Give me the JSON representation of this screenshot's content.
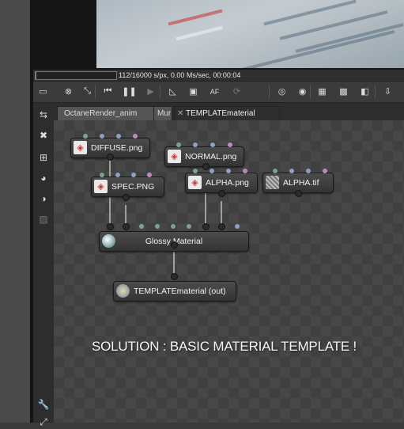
{
  "render": {
    "status": "112/16000 s/px, 0.00 Ms/sec, 00:00:04",
    "progress": 0.007
  },
  "toolbar": {
    "buttons": [
      {
        "name": "save-render-icon",
        "glyph": "▭"
      },
      {
        "name": "cancel-render-icon",
        "glyph": "⊗"
      },
      {
        "name": "fit-view-icon",
        "glyph": "⤡"
      },
      {
        "name": "restart-icon",
        "glyph": "⏮"
      },
      {
        "name": "pause-icon",
        "glyph": "❚❚"
      },
      {
        "name": "play-icon",
        "glyph": "▶"
      },
      {
        "name": "ruler-icon",
        "glyph": "◺"
      },
      {
        "name": "monitor-icon",
        "glyph": "▣"
      },
      {
        "name": "autofocus-icon",
        "glyph": "AF"
      },
      {
        "name": "rotate-icon",
        "glyph": "⟳"
      },
      {
        "name": "region-icon",
        "glyph": "◎"
      },
      {
        "name": "film-icon",
        "glyph": "◉"
      },
      {
        "name": "display-mode-icon",
        "glyph": "▦"
      },
      {
        "name": "alpha-checker-icon",
        "glyph": "▩"
      },
      {
        "name": "alpha-mask-icon",
        "glyph": "◧"
      },
      {
        "name": "export-icon",
        "glyph": "⇩"
      }
    ]
  },
  "side_toolbar": [
    {
      "name": "select-tool-icon",
      "glyph": "⇆"
    },
    {
      "name": "delete-node-icon",
      "glyph": "✖"
    },
    {
      "name": "add-node-icon",
      "glyph": "⊞"
    },
    {
      "name": "material-node-icon",
      "glyph": "◕"
    },
    {
      "name": "texture-node-icon",
      "glyph": "◑"
    },
    {
      "name": "camera-node-icon",
      "glyph": "▨"
    },
    {
      "name": "settings-wrench-icon",
      "glyph": "🔧"
    },
    {
      "name": "expand-icon",
      "glyph": "⤢"
    }
  ],
  "tabs": [
    {
      "label": "OctaneRender_anim",
      "active": false
    },
    {
      "label": "Mur",
      "active": false
    },
    {
      "label": "TEMPLATEmaterial",
      "active": true
    }
  ],
  "nodes": {
    "diffuse": "DIFFUSE.png",
    "normal": "NORMAL.png",
    "spec": "SPEC.PNG",
    "alpha_png": "ALPHA.png",
    "alpha_tif": "ALPHA.tif",
    "glossy": "Glossy Material",
    "output": "TEMPLATEmaterial (out)"
  },
  "annotation": "SOLUTION : BASIC MATERIAL TEMPLATE !",
  "colors": {
    "pin_green": "#7fa38a",
    "pin_blue": "#8f9fc6",
    "pin_pink": "#c48ab6",
    "wire": "#bfc8b4"
  }
}
